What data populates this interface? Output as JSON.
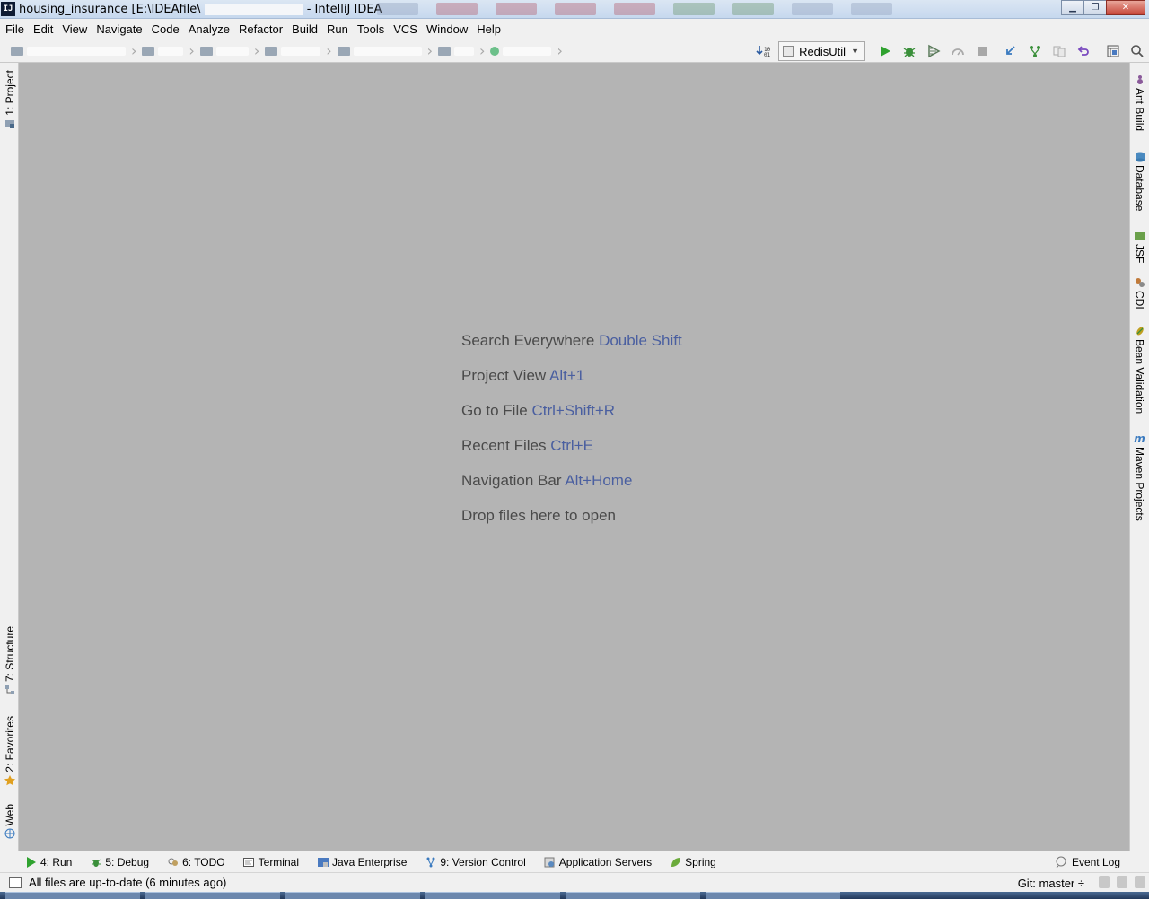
{
  "window": {
    "title_prefix": "housing_insurance [E:\\IDEAfile\\",
    "title_suffix": "- IntelliJ IDEA",
    "app_icon_label": "IJ",
    "minimize_label": "▁",
    "maximize_label": "❐",
    "close_label": "✕"
  },
  "menu": {
    "items": [
      "File",
      "Edit",
      "View",
      "Navigate",
      "Code",
      "Analyze",
      "Refactor",
      "Build",
      "Run",
      "Tools",
      "VCS",
      "Window",
      "Help"
    ]
  },
  "toolbar": {
    "run_config": "RedisUtil",
    "icons": [
      "build-icon",
      "run-config-icon",
      "run-icon",
      "debug-icon",
      "run-with-coverage-icon",
      "profile-icon",
      "stop-icon",
      "vcs-update-icon",
      "vcs-commit-icon",
      "vcs-compare-icon",
      "vcs-revert-icon",
      "project-structure-icon",
      "search-everywhere-icon"
    ]
  },
  "left_tabs": {
    "project": "1: Project",
    "structure": "7: Structure",
    "favorites": "2: Favorites",
    "web": "Web"
  },
  "right_tabs": {
    "ant": "Ant Build",
    "database": "Database",
    "jsf": "JSF",
    "cdi": "CDI",
    "bean_validation": "Bean Validation",
    "maven": "Maven Projects"
  },
  "editor_hints": [
    {
      "label": "Search Everywhere",
      "key": "Double Shift"
    },
    {
      "label": "Project View",
      "key": "Alt+1"
    },
    {
      "label": "Go to File",
      "key": "Ctrl+Shift+R"
    },
    {
      "label": "Recent Files",
      "key": "Ctrl+E"
    },
    {
      "label": "Navigation Bar",
      "key": "Alt+Home"
    },
    {
      "label": "Drop files here to open",
      "key": ""
    }
  ],
  "bottom_tabs": {
    "run": "4: Run",
    "debug": "5: Debug",
    "todo": "6: TODO",
    "terminal": "Terminal",
    "java_enterprise": "Java Enterprise",
    "version_control": "9: Version Control",
    "app_servers": "Application Servers",
    "spring": "Spring",
    "event_log": "Event Log"
  },
  "status": {
    "message": "All files are up-to-date (6 minutes ago)",
    "git": "Git: master ÷"
  },
  "colors": {
    "editor_bg": "#b4b4b4",
    "hint_text": "#4a4a4a",
    "shortcut": "#4a5fa0",
    "run_green": "#2fa22f"
  }
}
